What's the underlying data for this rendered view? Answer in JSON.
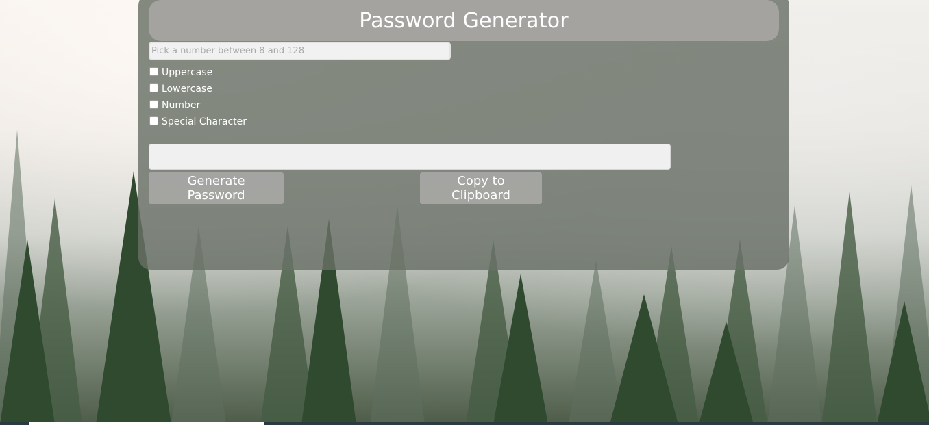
{
  "header": {
    "title": "Password Generator"
  },
  "length_input": {
    "placeholder": "Pick a number between 8 and 128",
    "value": ""
  },
  "options": [
    {
      "label": "Uppercase",
      "checked": false
    },
    {
      "label": "Lowercase",
      "checked": false
    },
    {
      "label": "Number",
      "checked": false
    },
    {
      "label": "Special Character",
      "checked": false
    }
  ],
  "output": {
    "value": ""
  },
  "buttons": {
    "generate_label": "Generate Password",
    "copy_label": "Copy to Clipboard"
  },
  "colors": {
    "card": "#697067",
    "header": "#aaa8a6",
    "button": "#aaaaa8",
    "text": "#ffffff"
  }
}
